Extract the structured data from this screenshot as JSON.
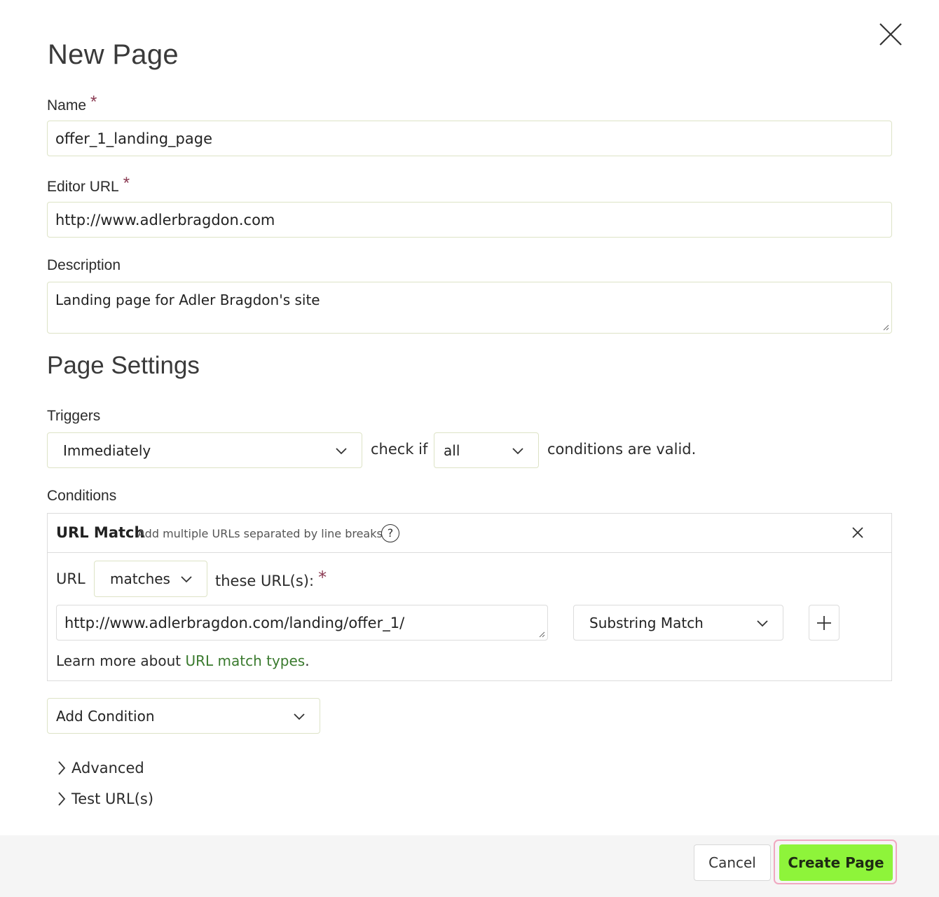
{
  "dialog": {
    "title": "New Page",
    "close_icon": "close-icon"
  },
  "fields": {
    "name": {
      "label": "Name",
      "required_mark": "*",
      "value": "offer_1_landing_page"
    },
    "editor_url": {
      "label": "Editor URL",
      "required_mark": "*",
      "value": "http://www.adlerbragdon.com"
    },
    "description": {
      "label": "Description",
      "value": "Landing page for Adler Bragdon's site"
    }
  },
  "page_settings": {
    "title": "Page Settings",
    "triggers": {
      "label": "Triggers",
      "selected": "Immediately",
      "check_if_text": "check if",
      "mode_selected": "all",
      "suffix_text": "conditions are valid."
    },
    "conditions": {
      "label": "Conditions",
      "url_match": {
        "title": "URL Match",
        "hint": "Add multiple URLs separated by line breaks",
        "help_glyph": "?",
        "url_label": "URL",
        "operator_selected": "matches",
        "these_text": "these",
        "urls_text": "URL(s):",
        "required_mark": "*",
        "url_value": "http://www.adlerbragdon.com/landing/offer_1/",
        "match_type_selected": "Substring Match",
        "learn_more_text": "Learn more about",
        "learn_more_link": "URL match types",
        "learn_more_end": "."
      },
      "add_condition": "Add Condition"
    },
    "advanced": "Advanced",
    "test_urls": "Test URL(s)"
  },
  "footer": {
    "cancel_label": "Cancel",
    "create_label": "Create Page"
  },
  "colors": {
    "primary_button": "#8ef43a",
    "focus_ring": "#f0a8c0",
    "link": "#3a7a2e",
    "required": "#8a3a52"
  }
}
